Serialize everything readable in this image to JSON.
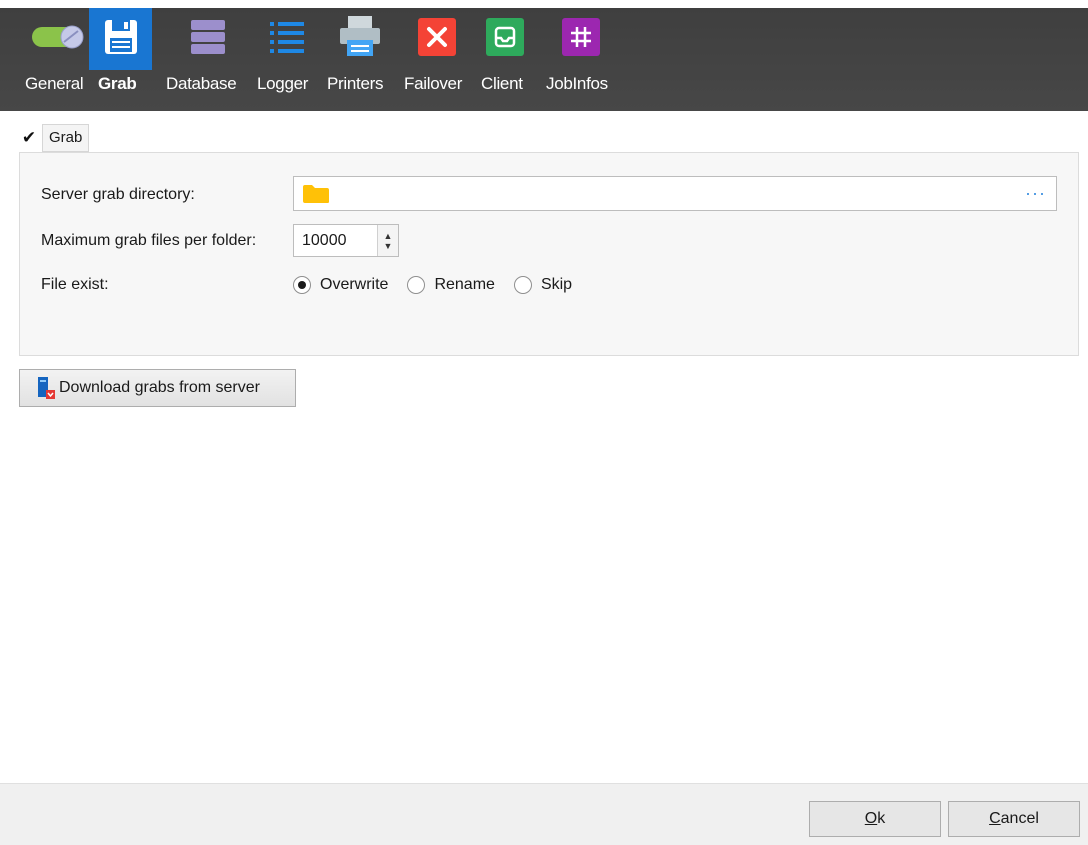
{
  "toolbar": {
    "items": [
      {
        "label": "General",
        "icon": "toggle-switch-icon",
        "active": false
      },
      {
        "label": "Grab",
        "icon": "floppy-disk-icon",
        "active": true
      },
      {
        "label": "Database",
        "icon": "database-stack-icon",
        "active": false
      },
      {
        "label": "Logger",
        "icon": "list-icon",
        "active": false
      },
      {
        "label": "Printers",
        "icon": "printer-icon",
        "active": false
      },
      {
        "label": "Failover",
        "icon": "close-x-icon",
        "active": false
      },
      {
        "label": "Client",
        "icon": "inbox-icon",
        "active": false
      },
      {
        "label": "JobInfos",
        "icon": "hashtag-icon",
        "active": false
      }
    ],
    "active_color": "#1976d2"
  },
  "grab_checkbox": {
    "label": "Grab",
    "checked": true,
    "glyph": "✔"
  },
  "form": {
    "server_grab_directory": {
      "label": "Server grab directory:",
      "value": "",
      "browse_label": "···"
    },
    "max_files": {
      "label": "Maximum grab files per folder:",
      "value": "10000",
      "up": "▲",
      "down": "▼"
    },
    "file_exist": {
      "label": "File exist:",
      "options": [
        "Overwrite",
        "Rename",
        "Skip"
      ],
      "selected": "Overwrite"
    }
  },
  "download_button": {
    "label": "Download grabs from server"
  },
  "footer": {
    "ok": {
      "mnemonic": "O",
      "rest": "k"
    },
    "cancel": {
      "mnemonic": "C",
      "rest": "ancel"
    }
  }
}
